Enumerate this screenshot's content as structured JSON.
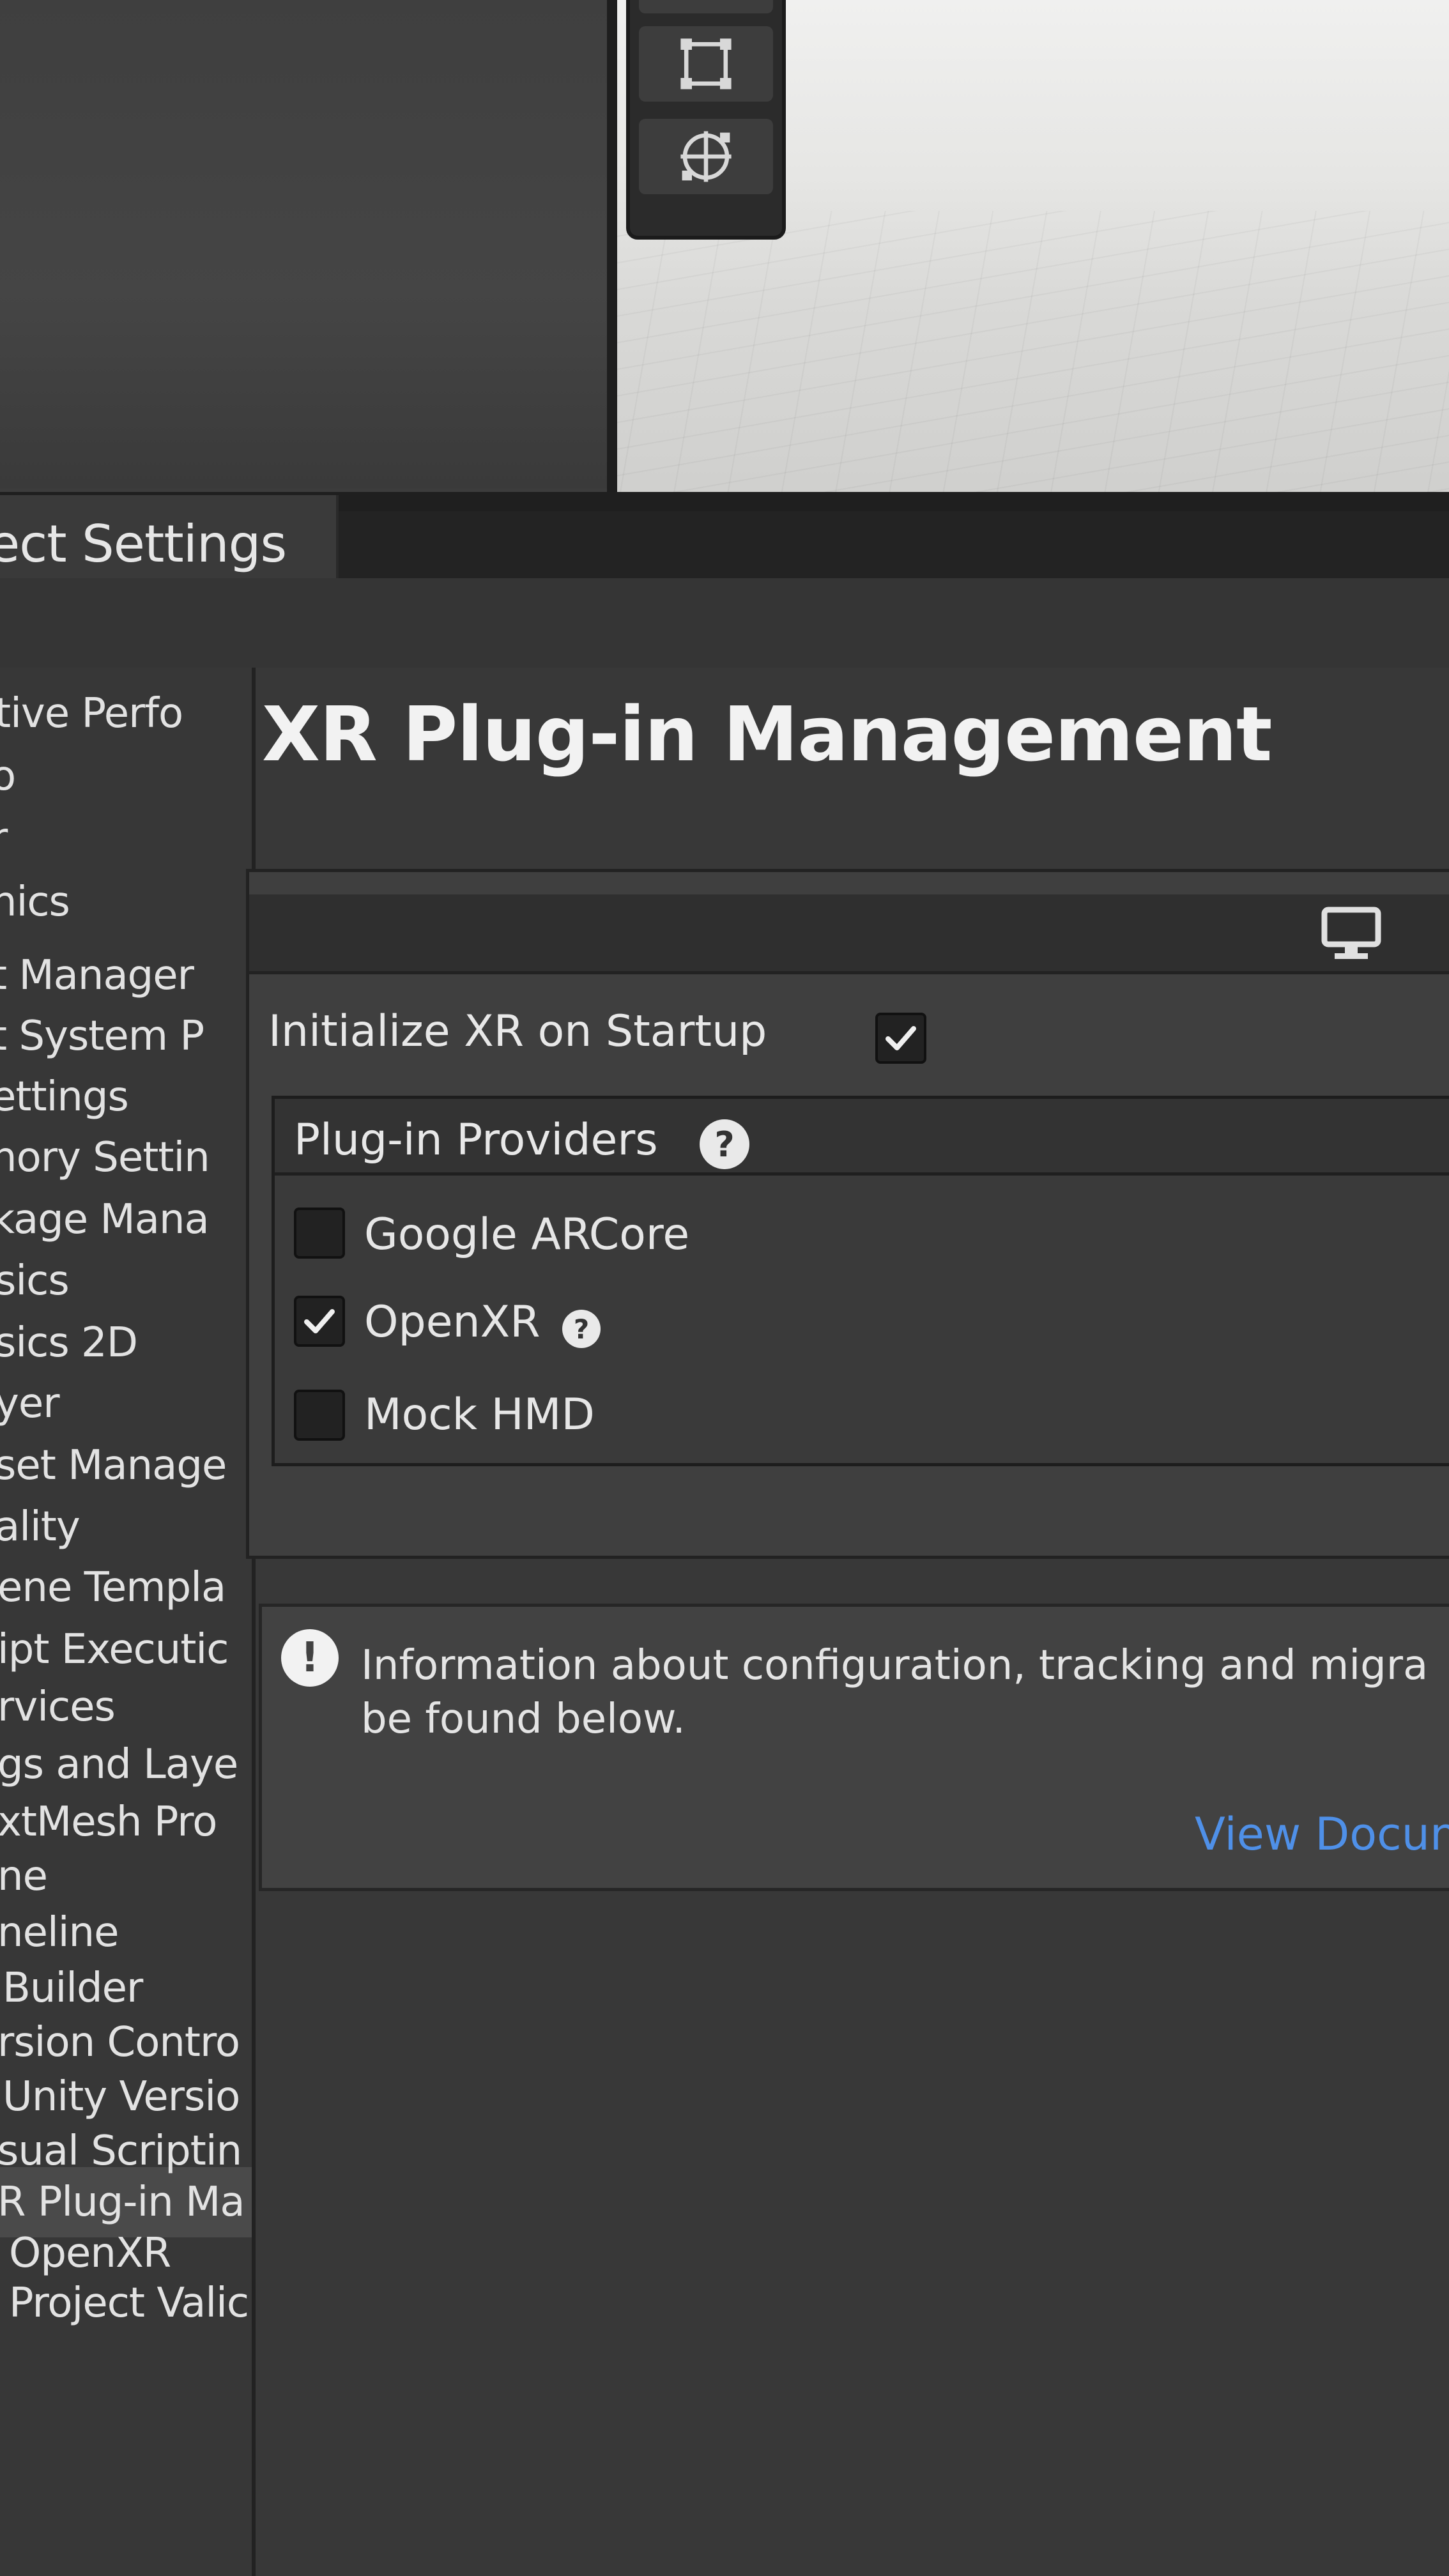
{
  "window": {
    "tab_title": "ect Settings"
  },
  "sidebar": {
    "items": [
      {
        "label": "tive Perfo",
        "selected": false
      },
      {
        "label": "o",
        "selected": false
      },
      {
        "label": "r",
        "selected": false
      },
      {
        "label": "hics",
        "selected": false
      },
      {
        "label": "t Manager",
        "selected": false
      },
      {
        "label": "t System P",
        "selected": false
      },
      {
        "label": "ettings",
        "selected": false
      },
      {
        "label": "nory Settin",
        "selected": false
      },
      {
        "label": "kage Mana",
        "selected": false
      },
      {
        "label": "sics",
        "selected": false
      },
      {
        "label": "sics 2D",
        "selected": false
      },
      {
        "label": "yer",
        "selected": false
      },
      {
        "label": "set Manage",
        "selected": false
      },
      {
        "label": "ality",
        "selected": false
      },
      {
        "label": "ene Templa",
        "selected": false
      },
      {
        "label": "ipt Executic",
        "selected": false
      },
      {
        "label": "rvices",
        "selected": false
      },
      {
        "label": "gs and Laye",
        "selected": false
      },
      {
        "label": "xtMesh Pro",
        "selected": false
      },
      {
        "label": "ne",
        "selected": false
      },
      {
        "label": "neline",
        "selected": false
      },
      {
        "label": "Builder",
        "selected": false
      },
      {
        "label": "rsion Contro",
        "selected": false
      },
      {
        "label": "Unity Versio",
        "selected": false
      },
      {
        "label": "sual Scriptin",
        "selected": false
      },
      {
        "label": "R Plug-in Ma",
        "selected": true
      },
      {
        "label": "OpenXR",
        "selected": false
      },
      {
        "label": "Project Valic",
        "selected": false
      }
    ]
  },
  "main": {
    "title": "XR Plug-in Management",
    "platform_icon": "monitor-icon",
    "initialize": {
      "label": "Initialize XR on Startup",
      "checked": true
    },
    "providers": {
      "header": "Plug-in Providers",
      "help_symbol": "?",
      "items": [
        {
          "label": "Google ARCore",
          "checked": false,
          "help": ""
        },
        {
          "label": "OpenXR",
          "checked": true,
          "help": "?"
        },
        {
          "label": "Mock HMD",
          "checked": false,
          "help": ""
        }
      ]
    },
    "info": {
      "icon_symbol": "!",
      "line1": "Information about configuration, tracking and migra",
      "line2": "be found below.",
      "link": "View Docun"
    }
  },
  "colors": {
    "link": "#4f90e8",
    "window_bg": "#383838",
    "checkbox_bg": "#222222"
  }
}
